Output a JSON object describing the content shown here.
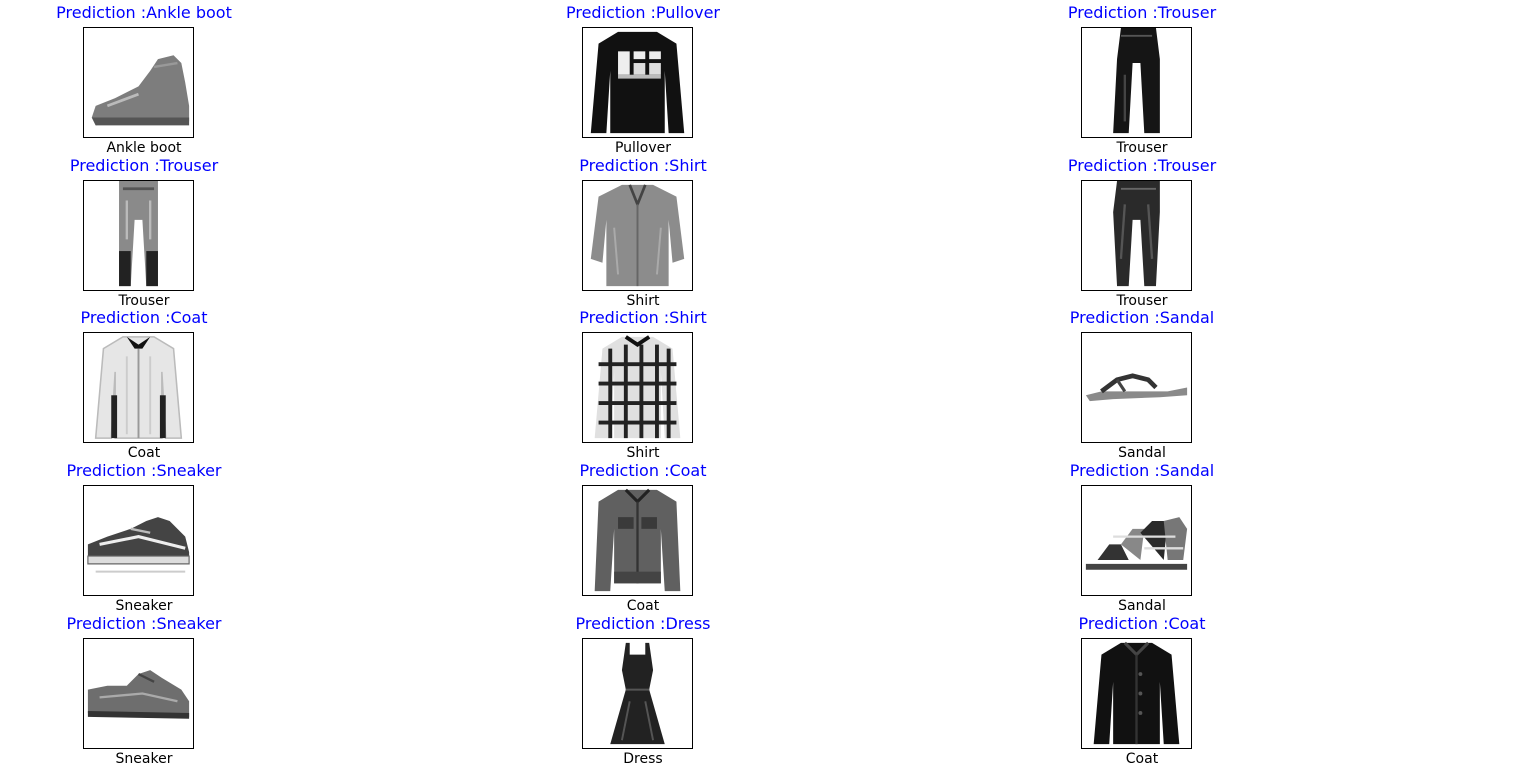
{
  "figure": {
    "title_color": "#0000ff",
    "items": [
      {
        "prediction": "Prediction :Ankle boot",
        "label": "Ankle boot",
        "icon": "ankle-boot-image"
      },
      {
        "prediction": "Prediction :Pullover",
        "label": "Pullover",
        "icon": "pullover-image"
      },
      {
        "prediction": "Prediction :Trouser",
        "label": "Trouser",
        "icon": "trouser-image"
      },
      {
        "prediction": "Prediction :Trouser",
        "label": "Trouser",
        "icon": "trouser-image"
      },
      {
        "prediction": "Prediction :Shirt",
        "label": "Shirt",
        "icon": "shirt-image"
      },
      {
        "prediction": "Prediction :Trouser",
        "label": "Trouser",
        "icon": "trouser-image"
      },
      {
        "prediction": "Prediction :Coat",
        "label": "Coat",
        "icon": "coat-image"
      },
      {
        "prediction": "Prediction :Shirt",
        "label": "Shirt",
        "icon": "plaid-shirt-image"
      },
      {
        "prediction": "Prediction :Sandal",
        "label": "Sandal",
        "icon": "flip-flop-image"
      },
      {
        "prediction": "Prediction :Sneaker",
        "label": "Sneaker",
        "icon": "sneaker-image"
      },
      {
        "prediction": "Prediction :Coat",
        "label": "Coat",
        "icon": "jacket-image"
      },
      {
        "prediction": "Prediction :Sandal",
        "label": "Sandal",
        "icon": "strappy-sandal-image"
      },
      {
        "prediction": "Prediction :Sneaker",
        "label": "Sneaker",
        "icon": "sneaker-image"
      },
      {
        "prediction": "Prediction :Dress",
        "label": "Dress",
        "icon": "dress-image"
      },
      {
        "prediction": "Prediction :Coat",
        "label": "Coat",
        "icon": "dark-coat-image"
      }
    ]
  }
}
